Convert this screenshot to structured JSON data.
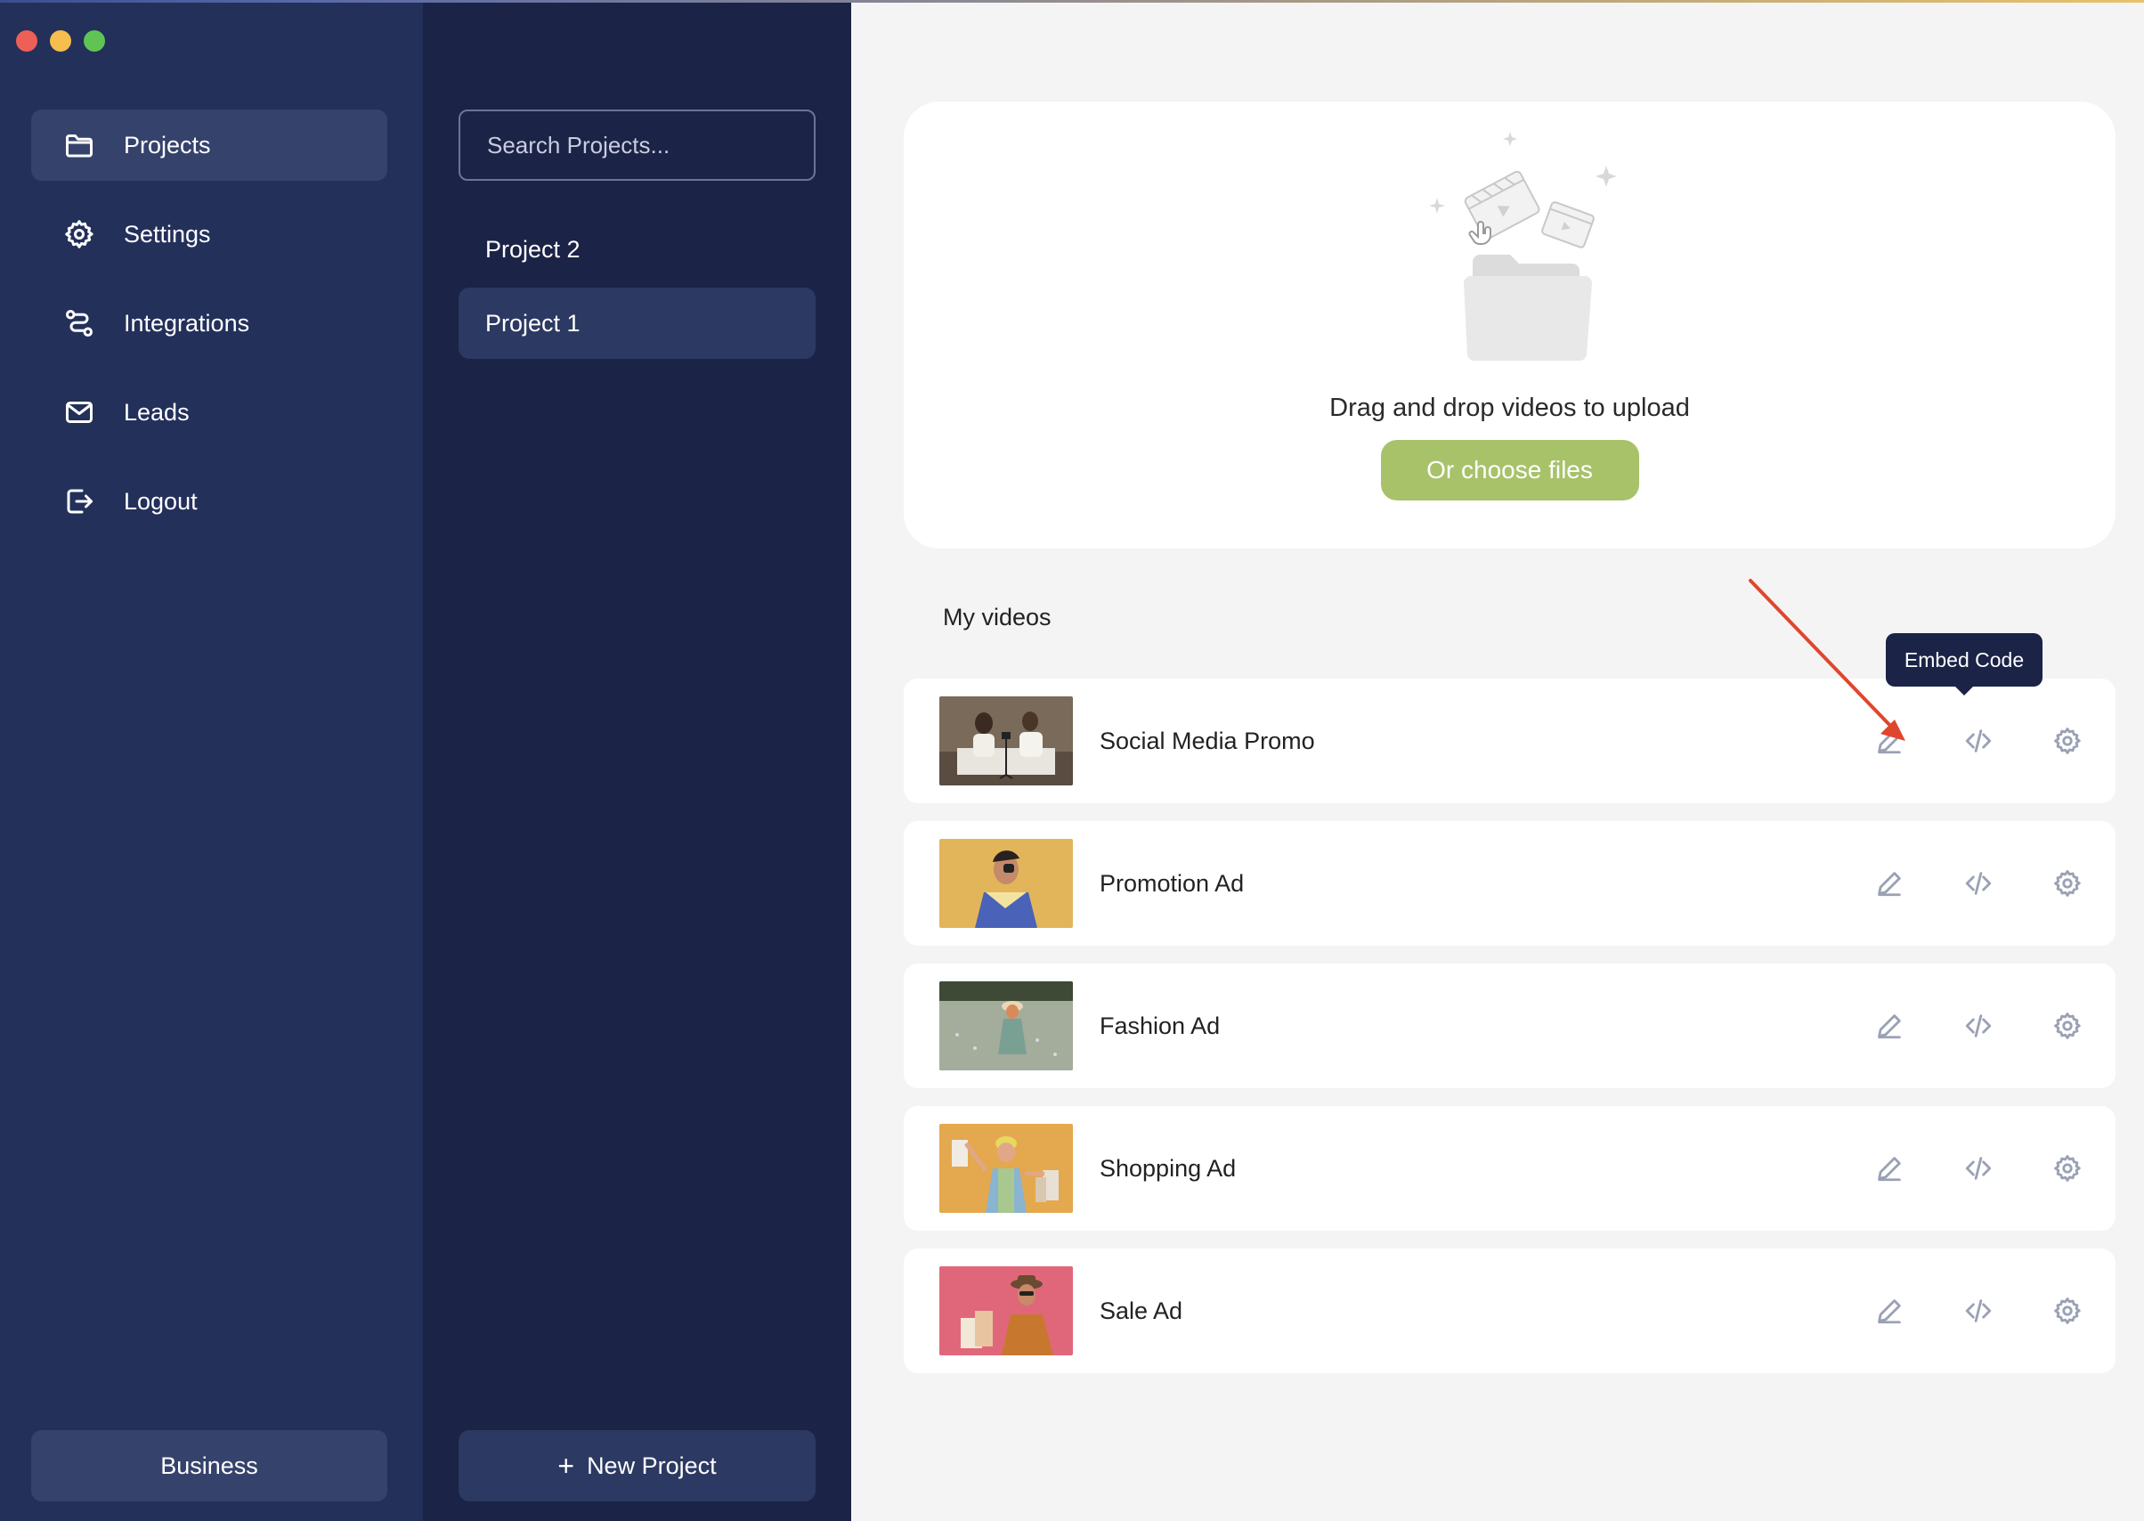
{
  "sidebar": {
    "items": [
      {
        "label": "Projects",
        "icon": "folder-icon",
        "active": true
      },
      {
        "label": "Settings",
        "icon": "gear-icon",
        "active": false
      },
      {
        "label": "Integrations",
        "icon": "integrations-icon",
        "active": false
      },
      {
        "label": "Leads",
        "icon": "mail-icon",
        "active": false
      },
      {
        "label": "Logout",
        "icon": "logout-icon",
        "active": false
      }
    ],
    "plan_label": "Business"
  },
  "projects_panel": {
    "search_placeholder": "Search Projects...",
    "projects": [
      {
        "label": "Project 2",
        "active": false
      },
      {
        "label": "Project 1",
        "active": true
      }
    ],
    "new_project_label": "New Project"
  },
  "upload": {
    "text": "Drag and drop videos to upload",
    "button_label": "Or choose files",
    "button_color": "#a8c26a"
  },
  "videos": {
    "section_title": "My videos",
    "items": [
      {
        "title": "Social Media Promo",
        "thumb_bg": "#7a6a5a"
      },
      {
        "title": "Promotion Ad",
        "thumb_bg": "#e2b55a"
      },
      {
        "title": "Fashion Ad",
        "thumb_bg": "#8e9a86"
      },
      {
        "title": "Shopping Ad",
        "thumb_bg": "#e4a84e"
      },
      {
        "title": "Sale Ad",
        "thumb_bg": "#e0677a"
      }
    ]
  },
  "tooltip": {
    "label": "Embed Code"
  },
  "colors": {
    "sidebar_bg": "#23305a",
    "panel_bg": "#1b2347",
    "annotation_arrow": "#e0462d"
  }
}
